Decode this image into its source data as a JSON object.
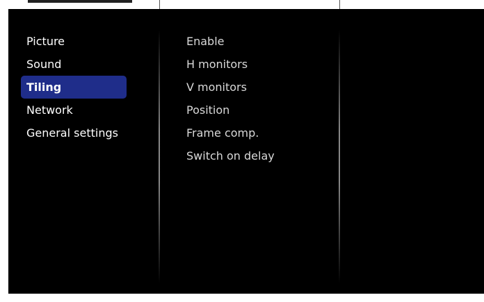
{
  "menu": {
    "items": [
      {
        "label": "Picture"
      },
      {
        "label": "Sound"
      },
      {
        "label": "Tiling"
      },
      {
        "label": "Network"
      },
      {
        "label": "General settings"
      }
    ],
    "selected_index": 2
  },
  "submenu": {
    "items": [
      {
        "label": "Enable"
      },
      {
        "label": "H monitors"
      },
      {
        "label": "V monitors"
      },
      {
        "label": "Position"
      },
      {
        "label": "Frame comp."
      },
      {
        "label": "Switch on delay"
      }
    ]
  },
  "colors": {
    "background": "#000000",
    "highlight": "#1f2d8a",
    "text": "#ffffff",
    "submenu_text": "#d9d9d9"
  }
}
